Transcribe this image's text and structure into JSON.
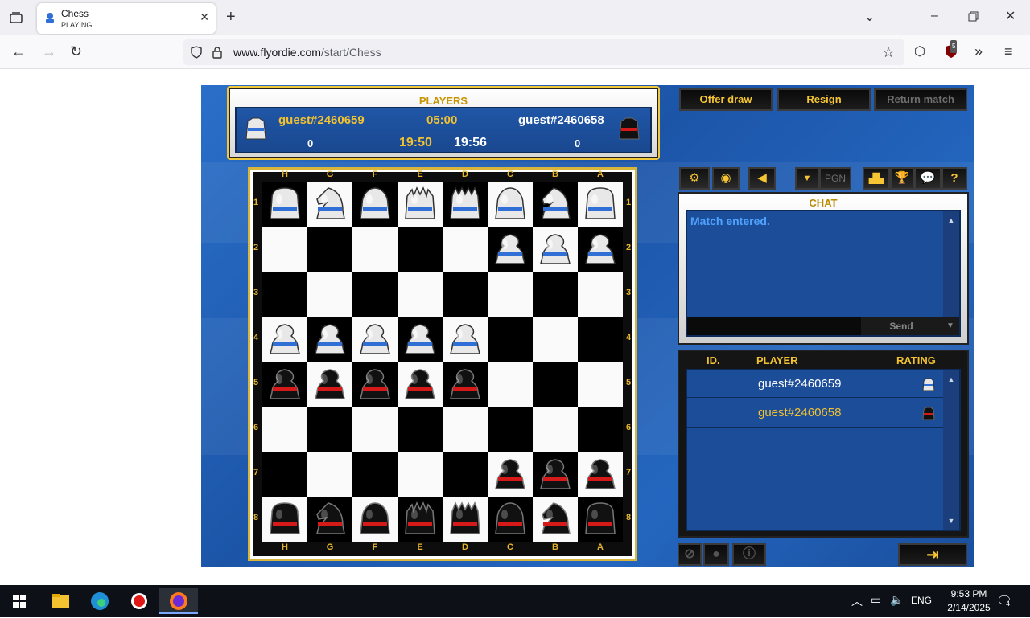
{
  "browser": {
    "tab_title": "Chess",
    "tab_status": "PLAYING",
    "url_domain": "www.flyordie.com",
    "url_path": "/start/Chess",
    "extension_badge": "5"
  },
  "players_panel": {
    "header": "PLAYERS",
    "white_name": "guest#2460659",
    "black_name": "guest#2460658",
    "base_time": "05:00",
    "white_score": "0",
    "black_score": "0",
    "white_clock": "19:50",
    "black_clock": "19:56"
  },
  "actions": {
    "offer_draw": "Offer draw",
    "resign": "Resign",
    "return_match": "Return match"
  },
  "toolbar": {
    "pgn": "PGN"
  },
  "board": {
    "files": [
      "H",
      "G",
      "F",
      "E",
      "D",
      "C",
      "B",
      "A"
    ],
    "ranks": [
      "1",
      "2",
      "3",
      "4",
      "5",
      "6",
      "7",
      "8"
    ],
    "rows": [
      [
        "wR",
        "wN",
        "wB",
        "wK",
        "wQ",
        "wB",
        "wN",
        "wR"
      ],
      [
        "",
        "",
        "",
        "",
        "",
        "wP",
        "wP",
        "wP"
      ],
      [
        "",
        "",
        "",
        "",
        "",
        "",
        "",
        ""
      ],
      [
        "wP",
        "wP",
        "wP",
        "wP",
        "wP",
        "",
        "",
        ""
      ],
      [
        "bP",
        "bP",
        "bP",
        "bP",
        "bP",
        "",
        "",
        ""
      ],
      [
        "",
        "",
        "",
        "",
        "",
        "",
        "",
        ""
      ],
      [
        "",
        "",
        "",
        "",
        "",
        "bP",
        "bP",
        "bP"
      ],
      [
        "bR",
        "bN",
        "bB",
        "bK",
        "bQ",
        "bB",
        "bN",
        "bR"
      ]
    ],
    "colors": {
      "white_piece": "#e8e8e8",
      "white_stripe": "#2f6fd6",
      "black_piece": "#111111",
      "black_stripe": "#d61a1a"
    }
  },
  "chat": {
    "header": "CHAT",
    "messages": [
      "Match entered."
    ],
    "send_label": "Send"
  },
  "player_list": {
    "col_id": "ID.",
    "col_player": "PLAYER",
    "col_rating": "RATING",
    "rows": [
      {
        "name": "guest#2460659",
        "color": "#ffffff",
        "piece": "white"
      },
      {
        "name": "guest#2460658",
        "color": "#f2c230",
        "piece": "black"
      }
    ]
  },
  "taskbar": {
    "language": "ENG",
    "time": "9:53 PM",
    "date": "2/14/2025",
    "notifications": "4"
  }
}
